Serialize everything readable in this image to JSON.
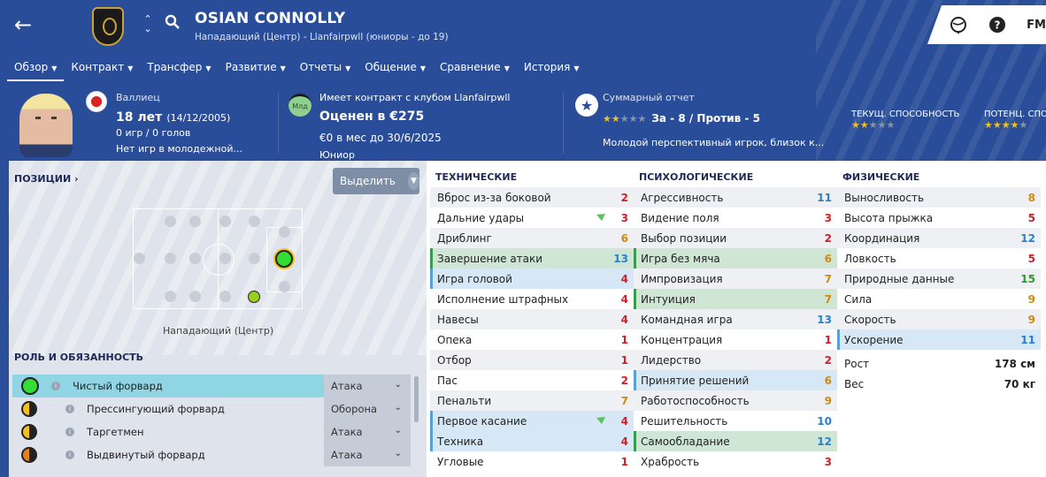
{
  "header": {
    "player_name": "OSIAN CONNOLLY",
    "subtitle": "Нападающий (Центр) - Llanfairpwll (юниоры - до 19)",
    "fm_label": "FM"
  },
  "nav": {
    "items": [
      {
        "label": "Обзор"
      },
      {
        "label": "Контракт"
      },
      {
        "label": "Трансфер"
      },
      {
        "label": "Развитие"
      },
      {
        "label": "Отчеты"
      },
      {
        "label": "Общение"
      },
      {
        "label": "Сравнение"
      },
      {
        "label": "История"
      }
    ]
  },
  "info": {
    "nationality": "Валлиец",
    "age": "18 лет",
    "dob": "(14/12/2005)",
    "apps": "0 игр / 0 голов",
    "youth": "Нет игр в молодежной...",
    "contract_label": "Имеет контракт с клубом Llanfairpwll",
    "value": "Оценен в €275",
    "wage": "€0 в мес до 30/6/2025",
    "contract_type": "Юниор",
    "badge_label": "Млд",
    "summary_label": "Суммарный отчет",
    "summary_pros_cons": "За - 8 / Против - 5",
    "summary_text": "Молодой перспективный игрок, близок к...",
    "current_ability_label": "ТЕКУЩ. СПОСОБНОСТЬ",
    "potential_ability_label": "ПОТЕНЦ. СПОСОБНОСТЬ",
    "summary_stars": 2,
    "current_ability_stars": 2,
    "potential_ability_stars": 4
  },
  "positions": {
    "title": "ПОЗИЦИИ",
    "highlight_button": "Выделить",
    "position_label": "Нападающий (Центр)"
  },
  "roles": {
    "title": "РОЛЬ И ОБЯЗАННОСТЬ",
    "items": [
      {
        "name": "Чистый форвард",
        "duty": "Атака"
      },
      {
        "name": "Прессингующий форвард",
        "duty": "Оборона"
      },
      {
        "name": "Таргетмен",
        "duty": "Атака"
      },
      {
        "name": "Выдвинутый форвард",
        "duty": "Атака"
      }
    ]
  },
  "technical": {
    "title": "ТЕХНИЧЕСКИЕ",
    "items": [
      {
        "name": "Вброс из-за боковой",
        "value": "2"
      },
      {
        "name": "Дальние удары",
        "value": "3"
      },
      {
        "name": "Дриблинг",
        "value": "6"
      },
      {
        "name": "Завершение атаки",
        "value": "13"
      },
      {
        "name": "Игра головой",
        "value": "4"
      },
      {
        "name": "Исполнение штрафных",
        "value": "4"
      },
      {
        "name": "Навесы",
        "value": "4"
      },
      {
        "name": "Опека",
        "value": "1"
      },
      {
        "name": "Отбор",
        "value": "1"
      },
      {
        "name": "Пас",
        "value": "2"
      },
      {
        "name": "Пенальти",
        "value": "7"
      },
      {
        "name": "Первое касание",
        "value": "4"
      },
      {
        "name": "Техника",
        "value": "4"
      },
      {
        "name": "Угловые",
        "value": "1"
      }
    ]
  },
  "mental": {
    "title": "ПСИХОЛОГИЧЕСКИЕ",
    "items": [
      {
        "name": "Агрессивность",
        "value": "11"
      },
      {
        "name": "Видение поля",
        "value": "3"
      },
      {
        "name": "Выбор позиции",
        "value": "2"
      },
      {
        "name": "Игра без мяча",
        "value": "6"
      },
      {
        "name": "Импровизация",
        "value": "7"
      },
      {
        "name": "Интуиция",
        "value": "7"
      },
      {
        "name": "Командная игра",
        "value": "13"
      },
      {
        "name": "Концентрация",
        "value": "1"
      },
      {
        "name": "Лидерство",
        "value": "2"
      },
      {
        "name": "Принятие решений",
        "value": "6"
      },
      {
        "name": "Работоспособность",
        "value": "9"
      },
      {
        "name": "Решительность",
        "value": "10"
      },
      {
        "name": "Самообладание",
        "value": "12"
      },
      {
        "name": "Храбрость",
        "value": "3"
      }
    ]
  },
  "physical": {
    "title": "ФИЗИЧЕСКИЕ",
    "items": [
      {
        "name": "Выносливость",
        "value": "8"
      },
      {
        "name": "Высота прыжка",
        "value": "5"
      },
      {
        "name": "Координация",
        "value": "12"
      },
      {
        "name": "Ловкость",
        "value": "5"
      },
      {
        "name": "Природные данные",
        "value": "15"
      },
      {
        "name": "Сила",
        "value": "9"
      },
      {
        "name": "Скорость",
        "value": "9"
      },
      {
        "name": "Ускорение",
        "value": "11"
      }
    ],
    "height_label": "Рост",
    "height_value": "178 см",
    "weight_label": "Вес",
    "weight_value": "70 кг"
  },
  "colors": {
    "header_bg": "#2a4d99",
    "value_low": "#d0202a",
    "value_mid": "#d08a10",
    "value_high": "#2a7fd0",
    "value_top": "#2a9a2a"
  }
}
